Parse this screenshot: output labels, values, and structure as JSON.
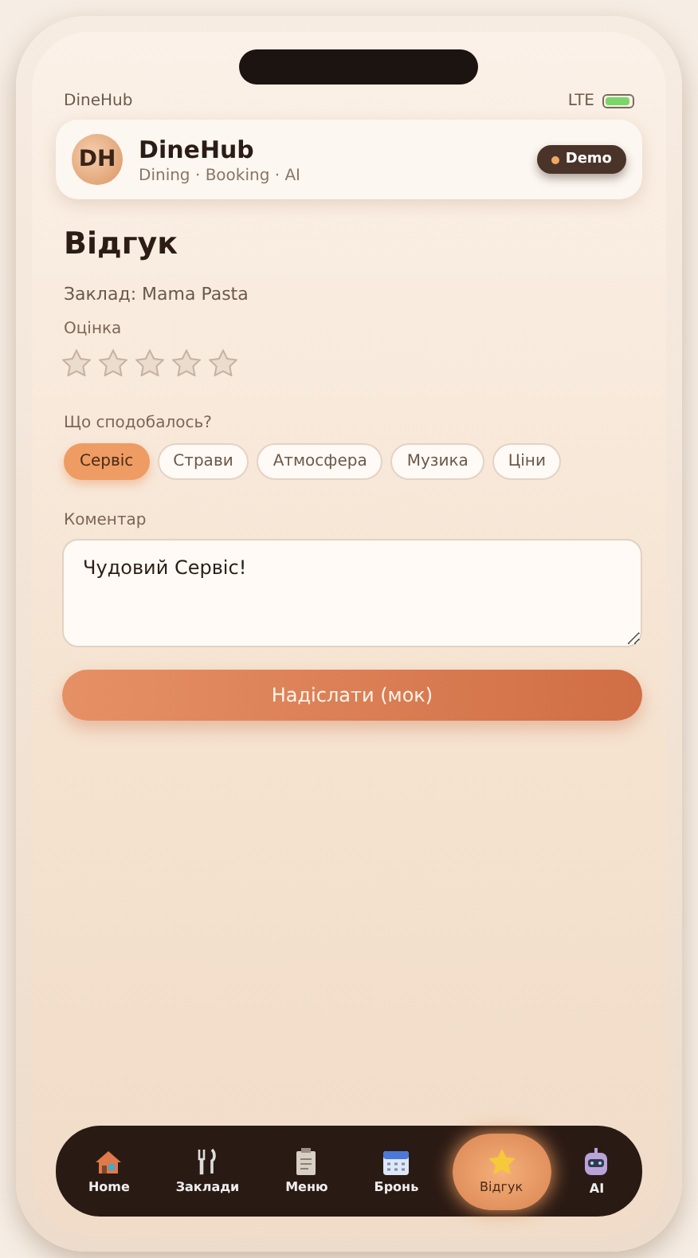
{
  "status_bar": {
    "app_name": "DineHub",
    "network": "LTE"
  },
  "header": {
    "avatar": "DH",
    "title": "DineHub",
    "subtitle": "Dining · Booking · AI",
    "badge": "Demo"
  },
  "review": {
    "title": "Відгук",
    "venue": "Заклад: Mama Pasta",
    "rating_label": "Оцінка",
    "rating": {
      "stars": 0
    },
    "liked_label": "Що сподобалось?",
    "tags": [
      {
        "label": "Сервіс",
        "selected": true
      },
      {
        "label": "Страви",
        "selected": false
      },
      {
        "label": "Атмосфера",
        "selected": false
      },
      {
        "label": "Музика",
        "selected": false
      },
      {
        "label": "Ціни",
        "selected": false
      }
    ],
    "comment_label": "Коментар",
    "comment": {
      "value": "Чудовий Сервіс!"
    },
    "submit": "Надіслати (мок)"
  },
  "nav": [
    {
      "kind": "home",
      "label": "Home",
      "selected": false
    },
    {
      "kind": "cutlery",
      "label": "Заклади",
      "selected": false
    },
    {
      "kind": "clipboard",
      "label": "Меню",
      "selected": false
    },
    {
      "kind": "calendar",
      "label": "Бронь",
      "selected": false
    },
    {
      "kind": "star",
      "label": "Відгук",
      "selected": true
    },
    {
      "kind": "robot",
      "label": "AI",
      "selected": false
    }
  ]
}
